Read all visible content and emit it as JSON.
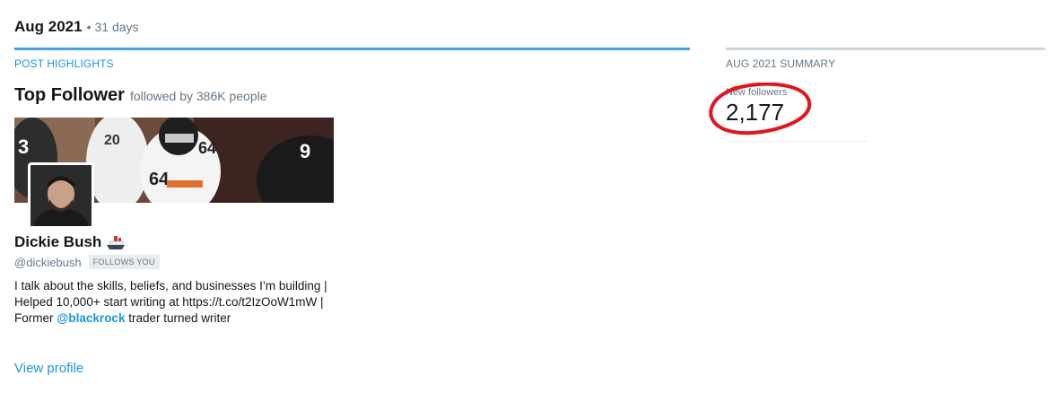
{
  "header": {
    "month": "Aug 2021",
    "separator": "•",
    "days": "31 days"
  },
  "post_highlights": {
    "label": "POST HIGHLIGHTS",
    "title": "Top Follower",
    "subtitle": "followed by 386K people",
    "follower": {
      "name": "Dickie Bush",
      "name_emoji_icon": "ship-icon",
      "handle": "@dickiebush",
      "badge": "FOLLOWS YOU",
      "bio_part1": "I talk about the skills, beliefs, and businesses I’m building | Helped 10,000+ start writing at https://t.co/t2IzOoW1mW | Former ",
      "bio_mention": "@blackrock",
      "bio_part2": " trader turned writer",
      "view_profile": "View profile"
    }
  },
  "summary": {
    "label": "AUG 2021 SUMMARY",
    "new_followers_label": "New followers",
    "new_followers_value": "2,177"
  },
  "colors": {
    "accent": "#1b95e0",
    "annotation": "#e0161c"
  }
}
